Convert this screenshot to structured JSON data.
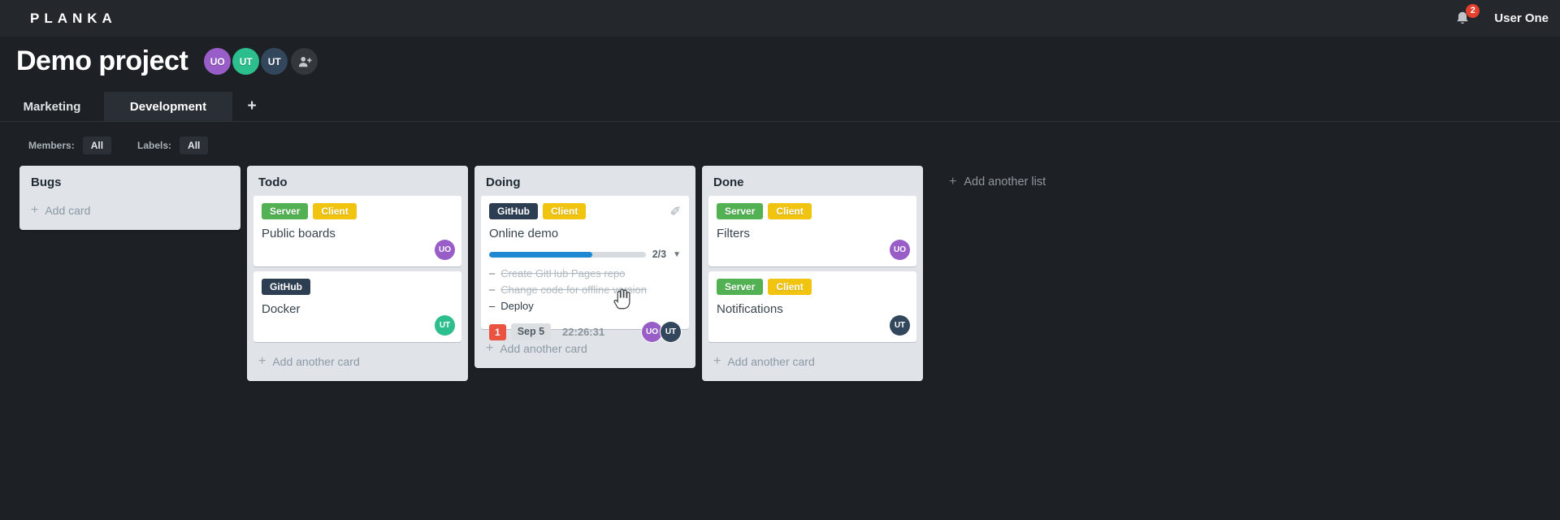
{
  "app": {
    "logo": "PLANKA",
    "user_name": "User One",
    "notification_count": "2"
  },
  "project": {
    "title": "Demo project",
    "members": [
      {
        "initials": "UO",
        "color": "#985dc7"
      },
      {
        "initials": "UT",
        "color": "#2cbe8c"
      },
      {
        "initials": "UT",
        "color": "#33475c"
      }
    ]
  },
  "tabs": {
    "items": [
      {
        "label": "Marketing"
      },
      {
        "label": "Development"
      }
    ],
    "add_label": "+"
  },
  "filters": {
    "members_label": "Members:",
    "members_value": "All",
    "labels_label": "Labels:",
    "labels_value": "All"
  },
  "colors": {
    "label_server": "#52b152",
    "label_client": "#f0c40f",
    "label_github": "#2d3e53",
    "progress_blue": "#1e88d2",
    "due_red": "#ea533f",
    "avatar_purple": "#985dc7",
    "avatar_green": "#2cbe8c",
    "avatar_navy": "#33475c"
  },
  "board": {
    "add_list_label": "Add another list",
    "lists": [
      {
        "title": "Bugs",
        "add_label": "Add card",
        "cards": []
      },
      {
        "title": "Todo",
        "add_label": "Add another card",
        "cards": [
          {
            "title": "Public boards",
            "labels": [
              {
                "text": "Server",
                "color": "#52b152"
              },
              {
                "text": "Client",
                "color": "#f0c40f"
              }
            ],
            "avatar": {
              "initials": "UO",
              "color": "#985dc7"
            }
          },
          {
            "title": "Docker",
            "labels": [
              {
                "text": "GitHub",
                "color": "#2d3e53"
              }
            ],
            "avatar": {
              "initials": "UT",
              "color": "#2cbe8c"
            }
          }
        ]
      },
      {
        "title": "Doing",
        "add_label": "Add another card",
        "cards": [
          {
            "title": "Online demo",
            "labels": [
              {
                "text": "GitHub",
                "color": "#2d3e53"
              },
              {
                "text": "Client",
                "color": "#f0c40f"
              }
            ],
            "edit_icon": "✎",
            "progress": {
              "label": "2/3",
              "width_pct": "66%",
              "color": "#1e88d2"
            },
            "tasks": [
              {
                "dash": "–",
                "text": "Create GitHub Pages repo",
                "done": true
              },
              {
                "dash": "–",
                "text": "Change code for offline version",
                "done": true
              },
              {
                "dash": "–",
                "text": "Deploy",
                "done": false
              }
            ],
            "meta": {
              "notification_count": "1",
              "due_date": "Sep 5",
              "timer": "22:26:31"
            },
            "avatars": [
              {
                "initials": "UO",
                "color": "#985dc7"
              },
              {
                "initials": "UT",
                "color": "#33475c"
              }
            ]
          }
        ]
      },
      {
        "title": "Done",
        "add_label": "Add another card",
        "cards": [
          {
            "title": "Filters",
            "labels": [
              {
                "text": "Server",
                "color": "#52b152"
              },
              {
                "text": "Client",
                "color": "#f0c40f"
              }
            ],
            "avatar": {
              "initials": "UO",
              "color": "#985dc7"
            }
          },
          {
            "title": "Notifications",
            "labels": [
              {
                "text": "Server",
                "color": "#52b152"
              },
              {
                "text": "Client",
                "color": "#f0c40f"
              }
            ],
            "avatar": {
              "initials": "UT",
              "color": "#33475c"
            }
          }
        ]
      }
    ]
  }
}
